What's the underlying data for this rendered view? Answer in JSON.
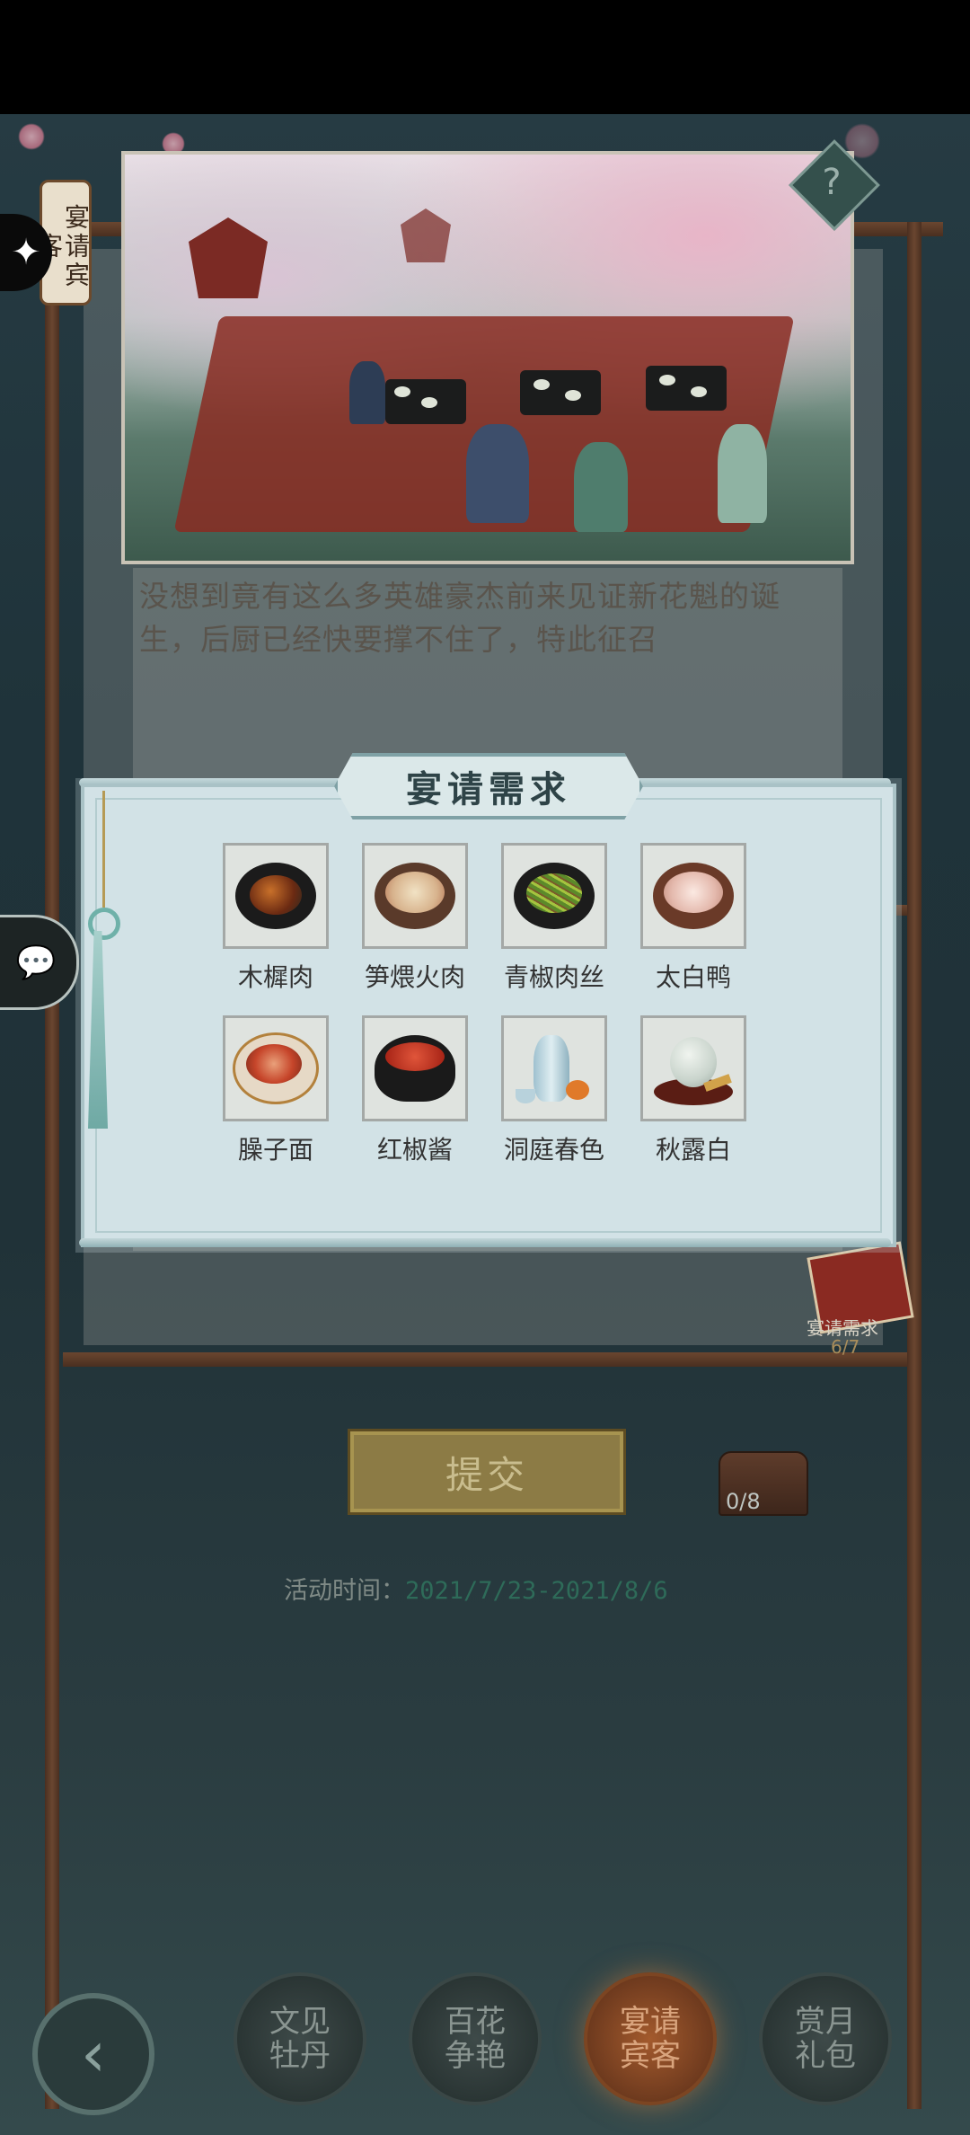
{
  "side_tab": {
    "label": "宴请宾客"
  },
  "story_text": "没想到竟有这么多英雄豪杰前来见证新花魁的诞生，后厨已经快要撑不住了，特此征召",
  "modal": {
    "title": "宴请需求",
    "items": [
      {
        "name": "木樨肉",
        "icon": "stir-fry-pork-icon"
      },
      {
        "name": "笋煨火肉",
        "icon": "bamboo-ham-stew-icon"
      },
      {
        "name": "青椒肉丝",
        "icon": "pepper-pork-shreds-icon"
      },
      {
        "name": "太白鸭",
        "icon": "taibai-duck-icon"
      },
      {
        "name": "臊子面",
        "icon": "noodle-bowl-icon"
      },
      {
        "name": "红椒酱",
        "icon": "red-pepper-sauce-icon"
      },
      {
        "name": "洞庭春色",
        "icon": "porcelain-wine-set-icon"
      },
      {
        "name": "秋露白",
        "icon": "teapot-tray-icon"
      }
    ]
  },
  "requirement_badge": {
    "label": "宴请需求",
    "count": "6/7"
  },
  "submit_button": {
    "label": "提交"
  },
  "chest": {
    "count": "0/8"
  },
  "activity": {
    "prefix": "活动时间：",
    "date": "2021/7/23-2021/8/6"
  },
  "bottom_nav": [
    {
      "label": "文见\n牡丹",
      "active": false
    },
    {
      "label": "百花\n争艳",
      "active": false
    },
    {
      "label": "宴请\n宾客",
      "active": true
    },
    {
      "label": "赏月\n礼包",
      "active": false
    }
  ],
  "colors": {
    "accent_active": "#a35a2d",
    "modal_bg": "#d2e2e6",
    "date_text": "#2e6b59"
  }
}
